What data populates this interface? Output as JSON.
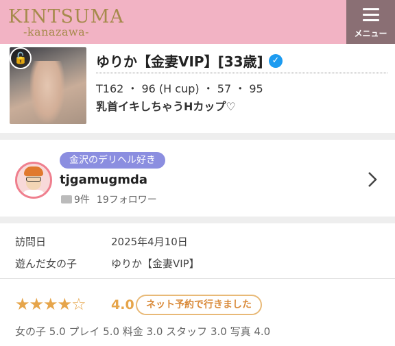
{
  "header": {
    "brand_name": "KINTSUMA",
    "brand_sub": "-kanazawa-",
    "menu_label": "メニュー",
    "background_color": "#f2b3c4"
  },
  "profile": {
    "girl_name": "ゆりか【金妻VIP】[33歳]",
    "stats": "T162 ・ 96 (H cup) ・ 57 ・ 95",
    "catchphrase": "乳首イキしちゃうHカップ♡",
    "icons": [
      "lock-icon",
      "verified-icon"
    ]
  },
  "reviewer": {
    "tag": "金沢のデリヘル好き",
    "username": "tjgamugmda",
    "comment_count": "9件",
    "followers": "19フォロワー",
    "tag_color": "#8b8ee0"
  },
  "visit": {
    "date_label": "訪問日",
    "date_value": "2025年4月10日",
    "girl_label": "遊んだ女の子",
    "girl_value": "ゆりか【金妻VIP】"
  },
  "rating": {
    "stars": "★★★★☆",
    "score": "4.0",
    "stars_value": 4,
    "stars_max": 5,
    "badge": "ネット予約で行きました",
    "breakdown": "女の子 5.0 プレイ 5.0 料金 3.0 スタッフ 3.0 写真 4.0",
    "accent_color": "#e6a54b"
  }
}
